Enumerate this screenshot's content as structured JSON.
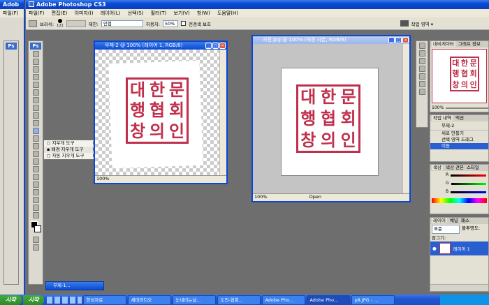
{
  "app": {
    "title_back": "Adob",
    "title": "Adobe Photoshop CS3",
    "menu_back": "파일(F)"
  },
  "menu": [
    "파일(F)",
    "편집(E)",
    "이미지(I)",
    "레이어(L)",
    "선택(S)",
    "필터(T)",
    "보기(V)",
    "창(W)",
    "도움말(H)"
  ],
  "options": {
    "brush_label": "브러쉬:",
    "brush_size": "121",
    "limit_label": "제한:",
    "limit_value": "인접",
    "tolerance_label": "허용치:",
    "tolerance_value": "50%",
    "checkbox_label": "전경색 보호",
    "workspace_label": "작업 영역 ▾"
  },
  "toolbox": {
    "logo": "Ps"
  },
  "flyout": {
    "items": [
      "지우개 도구",
      "배경 지우개 도구",
      "자동 지우개 도구"
    ],
    "shortcut": "E"
  },
  "doc1": {
    "title": "무제-2 @ 100% (레이어 1, RGB/8)",
    "zoom": "100%",
    "min_title": "무제-1..."
  },
  "doc2": {
    "title": "사진.jpg @ 100% (배경 사본, RGB/8)",
    "zoom": "100%",
    "status": "Open"
  },
  "stamp": {
    "chars": [
      "대",
      "한",
      "문",
      "행",
      "협",
      "회",
      "창",
      "의",
      "인"
    ]
  },
  "navigator": {
    "tabs": [
      "내비게이터",
      "그래프 정보"
    ],
    "zoom": "100%"
  },
  "history": {
    "tabs": [
      "작업 내역",
      "액션"
    ],
    "doc": "무제-2",
    "items": [
      "새로 만들기",
      "선택 영역 드래그",
      "이동"
    ]
  },
  "color": {
    "tabs": [
      "색상",
      "색상 견본",
      "스타일"
    ],
    "channels": [
      "R",
      "G",
      "B"
    ]
  },
  "layers": {
    "tabs": [
      "레이어",
      "채널",
      "패스"
    ],
    "mode": "표준",
    "opacity_label": "불투명도:",
    "lock_label": "잠그기:",
    "layer_name": "레이어 1"
  },
  "taskbar": {
    "start": "시작",
    "start_back": "시작",
    "items": [
      "한성자료",
      "세미라디오",
      "눈내리는날...",
      "도안-협회...",
      "Adobe Pho...",
      "Adobe Pho...",
      "p8.JPG - ..."
    ]
  },
  "colors": {
    "accent": "#0a46d8",
    "stamp": "#c0304c"
  }
}
